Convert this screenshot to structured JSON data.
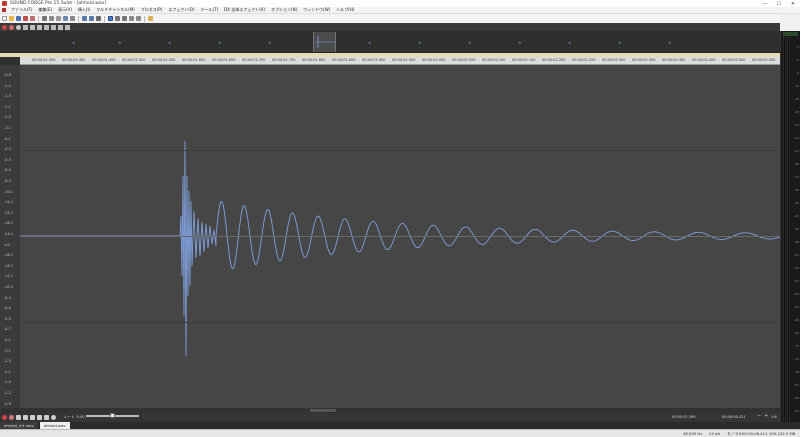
{
  "window": {
    "title": "SOUND FORGE Pro 15 Suite - [ahhoid.wav]",
    "minimize": "—",
    "maximize": "☐",
    "close": "✕"
  },
  "menu": {
    "items": [
      "ファイル(F)",
      "編集(E)",
      "表示(V)",
      "挿入(I)",
      "マルチチャンネル(M)",
      "プロセス(P)",
      "エフェクト(O)",
      "ツール(T)",
      "DX 全体エフェクト(X)",
      "オプション(N)",
      "ウィンドウ(W)",
      "ヘルプ(H)"
    ]
  },
  "ruler": {
    "labels": [
      "00:00:01.350",
      "00:00:01.400",
      "00:00:01.450",
      "00:00:01.500",
      "00:00:01.550",
      "00:00:01.600",
      "00:00:01.650",
      "00:00:01.700",
      "00:00:01.750",
      "00:00:01.800",
      "00:00:01.850",
      "00:00:01.900",
      "00:00:01.950",
      "00:00:02.000",
      "00:00:02.050",
      "00:00:02.100",
      "00:00:02.150",
      "00:00:02.200",
      "00:00:02.250",
      "00:00:02.300",
      "00:00:02.350",
      "00:00:02.400",
      "00:00:02.450",
      "00:00:02.500",
      "00:00:02.550"
    ]
  },
  "yaxis": {
    "labels": [
      "-0.9",
      "-1.2",
      "-1.5",
      "-2.1",
      "-2.5",
      "-3.1",
      "-4.1",
      "-4.7",
      "-5.5",
      "-6.5",
      "-8.3",
      "-10.1",
      "-12.1",
      "-15.1",
      "-18.1",
      "-24.1",
      "-Inf",
      "-18.1",
      "-15.1",
      "-12.1",
      "-10.1",
      "-8.3",
      "-6.5",
      "-5.5",
      "-4.7",
      "-4.1",
      "-3.1",
      "-2.5",
      "-2.1",
      "-1.5",
      "-1.2",
      "-0.9"
    ]
  },
  "meter": {
    "labels": [
      "-3",
      "-6",
      "-9",
      "-12",
      "-15",
      "-18",
      "-21",
      "-24",
      "-27",
      "-30",
      "-33",
      "-36",
      "-39",
      "-42",
      "-45",
      "-48",
      "-51",
      "-54",
      "-57",
      "-60",
      "-63",
      "-66",
      "-69",
      "-72",
      "-75",
      "-78",
      "-81",
      "-84",
      "-87"
    ]
  },
  "transport": {
    "rate_label": "レート: 0.00",
    "selection_start": "00:00:01.309",
    "selection_end": "00:00:08.411",
    "zoom_level": "1:6"
  },
  "doc_tabs": [
    "ahhoid_m1.wav",
    "ahhoid.wav"
  ],
  "status": {
    "sample_rate": "48,000 Hz",
    "bit_depth": "24 bit",
    "channels": "モノラル",
    "length": "00:00:06.411",
    "disk_free": "105,102.5 MB"
  },
  "colors": {
    "waveform": "#7f9fdc",
    "accent": "#5b7fc0",
    "background": "#464646"
  }
}
